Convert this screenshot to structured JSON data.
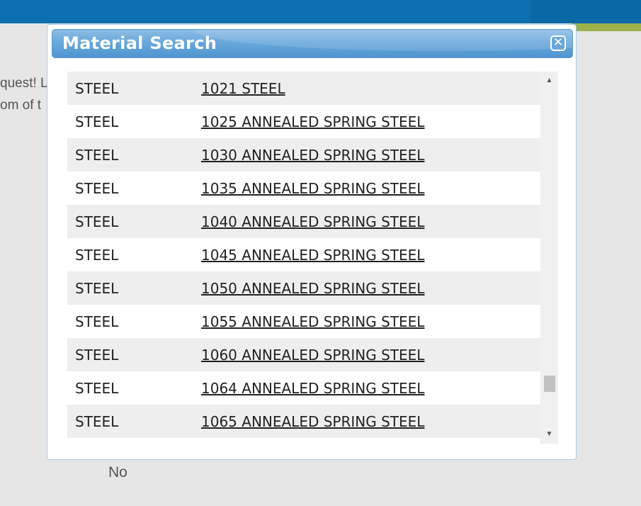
{
  "background": {
    "text_line_1": "quest! L",
    "text_line_2": "om of t",
    "no_label": "No"
  },
  "dialog": {
    "title": "Material Search",
    "close_glyph": "✕",
    "rows": [
      {
        "category": "STEEL",
        "name": "1021 STEEL"
      },
      {
        "category": "STEEL",
        "name": "1025 ANNEALED SPRING STEEL"
      },
      {
        "category": "STEEL",
        "name": "1030 ANNEALED SPRING STEEL"
      },
      {
        "category": "STEEL",
        "name": "1035 ANNEALED SPRING STEEL"
      },
      {
        "category": "STEEL",
        "name": "1040 ANNEALED SPRING STEEL"
      },
      {
        "category": "STEEL",
        "name": "1045 ANNEALED SPRING STEEL"
      },
      {
        "category": "STEEL",
        "name": "1050 ANNEALED SPRING STEEL"
      },
      {
        "category": "STEEL",
        "name": "1055 ANNEALED SPRING STEEL"
      },
      {
        "category": "STEEL",
        "name": "1060 ANNEALED SPRING STEEL"
      },
      {
        "category": "STEEL",
        "name": "1064 ANNEALED SPRING STEEL"
      },
      {
        "category": "STEEL",
        "name": "1065 ANNEALED SPRING STEEL"
      }
    ]
  },
  "scrollbar": {
    "up_arrow": "▲",
    "down_arrow": "▼"
  },
  "colors": {
    "header_blue": "#0d6fb0",
    "accent_green": "#9cb34a",
    "title_bar_blue": "#6aa8db"
  }
}
